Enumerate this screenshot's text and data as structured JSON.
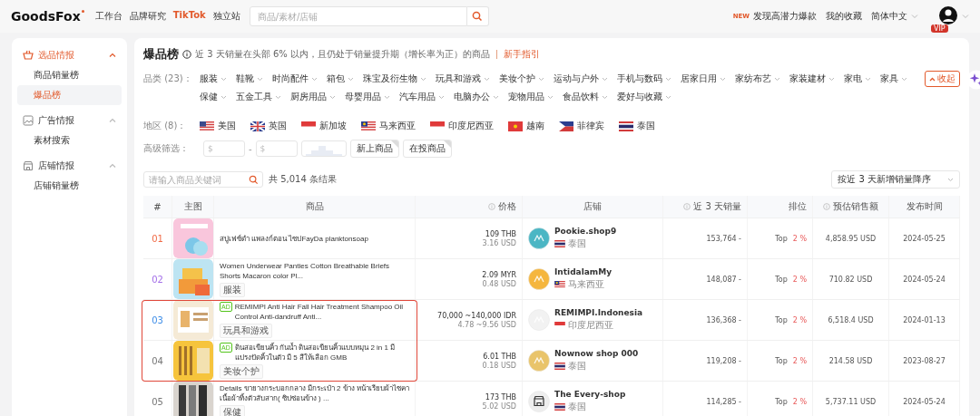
{
  "header": {
    "logo": "GoodsFox",
    "nav": [
      {
        "label": "工作台",
        "selected": false
      },
      {
        "label": "品牌研究",
        "selected": false
      },
      {
        "label": "TikTok",
        "selected": true
      },
      {
        "label": "独立站",
        "selected": false
      }
    ],
    "search": {
      "placeholder": "商品/素材/店铺"
    },
    "new_badge": "NEW",
    "discover": "发现高潜力爆款",
    "favorites": "我的收藏",
    "language": "简体中文",
    "vip": "VIP"
  },
  "sidebar": [
    {
      "label": "选品情报",
      "expanded": true,
      "active": true,
      "items": [
        {
          "label": "商品销量榜",
          "selected": false
        },
        {
          "label": "爆品榜",
          "selected": true
        }
      ]
    },
    {
      "label": "广告情报",
      "expanded": true,
      "active": false,
      "items": [
        {
          "label": "素材搜索",
          "selected": false
        }
      ]
    },
    {
      "label": "店铺情报",
      "expanded": true,
      "active": false,
      "items": [
        {
          "label": "店铺销量榜",
          "selected": false
        }
      ]
    }
  ],
  "page": {
    "title": "爆品榜",
    "description": "近 3 天销量在头部 6% 以内，且仍处于销量提升期（增长率为正）的商品",
    "guide_link": "新手指引"
  },
  "categories": {
    "label": "品类 (23)：",
    "collapse": "收起",
    "items": [
      "服装",
      "鞋靴",
      "时尚配件",
      "箱包",
      "珠宝及衍生物",
      "玩具和游戏",
      "美妆个护",
      "运动与户外",
      "手机与数码",
      "居家日用",
      "家纺布艺",
      "家装建材",
      "家电",
      "家具",
      "保健",
      "五金工具",
      "厨房用品",
      "母婴用品",
      "汽车用品",
      "电脑办公",
      "宠物用品",
      "食品饮料",
      "爱好与收藏"
    ]
  },
  "regions": {
    "label": "地区 (8)：",
    "items": [
      "美国",
      "英国",
      "新加坡",
      "马来西亚",
      "印度尼西亚",
      "越南",
      "菲律宾",
      "泰国"
    ]
  },
  "advanced": {
    "label": "高级筛选：",
    "min_placeholder": "$",
    "separator": "-",
    "max_placeholder": "$",
    "toggles": [
      {
        "label": "新上商品",
        "checked": false
      },
      {
        "label": "在投商品",
        "checked": false
      }
    ]
  },
  "table_search": {
    "placeholder": "请输入商品关键词"
  },
  "result_count": "共 5,014 条结果",
  "sort": "按近 3 天新增销量降序",
  "columns": [
    {
      "label": "#",
      "info": false
    },
    {
      "label": "主图",
      "info": false
    },
    {
      "label": "商品",
      "info": false
    },
    {
      "label": "价格",
      "info": true
    },
    {
      "label": "店铺",
      "info": false
    },
    {
      "label": "近 3 天销量",
      "info": true
    },
    {
      "label": "排位",
      "info": false
    },
    {
      "label": "预估销售额",
      "info": true
    },
    {
      "label": "发布时间",
      "info": false
    }
  ],
  "rows": [
    {
      "rank": "01",
      "color": "#f06a45",
      "ad": false,
      "title": "สบู่เฟซ์ดำ แพลงก์ตอน ไซปFayDa planktonsoap",
      "price": "109 THB",
      "price_usd": "3.16 USD",
      "store": {
        "name": "Pookie.shop9",
        "country": "泰国",
        "kind": "logo",
        "color": "#4bb6c4"
      },
      "sales": "153,764 -",
      "rank_label": "Top",
      "rank_value": "2 %",
      "revenue": "4,858.95 USD",
      "date": "2024-05-25",
      "highlighted": false
    },
    {
      "rank": "02",
      "color": "#a36ee8",
      "ad": false,
      "title": "Women Underwear Panties Cotton Breathable Briefs Shorts Macaron color Pl...",
      "tag": "服装",
      "price": "2.09 MYR",
      "price_usd": "0.48 USD",
      "store": {
        "name": "IntidalamMy",
        "country": "马来西亚",
        "kind": "logo",
        "color": "#f5b63e"
      },
      "sales": "148,087 -",
      "rank_label": "Top",
      "rank_value": "2 %",
      "revenue": "710.82 USD",
      "date": "2024-05-24",
      "highlighted": false
    },
    {
      "rank": "03",
      "color": "#3f8ee8",
      "ad": true,
      "ad_label": "AD",
      "title": "REMIMPI Anti Hair Fall Hair Treatment Shampoo Oil Control Anti-dandruff Anti...",
      "tag": "玩具和游戏",
      "price": "70,000 ~140,000 IDR",
      "price_usd": "4.78 ~9.56 USD",
      "store": {
        "name": "REMIMPI.Indonesia",
        "country": "印度尼西亚",
        "kind": "logo",
        "color": "#f2f2f2"
      },
      "sales": "136,368 -",
      "rank_label": "Top",
      "rank_value": "2 %",
      "revenue": "6,518.4 USD",
      "date": "2024-01-13",
      "highlighted": true
    },
    {
      "rank": "04",
      "color": "#777777",
      "ad": true,
      "ad_label": "AD",
      "title": "ดินสอเขียนคิ้ว กันน้ำ ดินสอเขียนคิ้วแบบหมุน 2 in 1 มีแปรงปัดคิ้วในตัว มี 5 สีให้เลือก GMB",
      "tag": "美妆个护",
      "price": "6.01 THB",
      "price_usd": "0.18 USD",
      "store": {
        "name": "Nownow shop 000",
        "country": "泰国",
        "kind": "logo",
        "color": "#e9c46a"
      },
      "sales": "119,208 -",
      "rank_label": "Top",
      "rank_value": "2 %",
      "revenue": "214.58 USD",
      "date": "2023-08-27",
      "highlighted": true
    },
    {
      "rank": "05",
      "color": "#777777",
      "ad": false,
      "title": "Details ขายางกระบอกกลาง มีกระเป๋า 2 ข้าง หน้าเรียบผ้าไซคา เนื้อผ้าทิ้งตัวสับสาก( ซิปซ่อนข้าง ) ...",
      "tag": "保健",
      "price": "173 THB",
      "price_usd": "5.02 USD",
      "store": {
        "name": "The Every-shop",
        "country": "泰国",
        "kind": "store",
        "color": "#eeeeee"
      },
      "sales": "114,285 -",
      "rank_label": "Top",
      "rank_value": "2 %",
      "revenue": "5,737.11 USD",
      "date": "2024-05-24",
      "highlighted": false
    }
  ]
}
